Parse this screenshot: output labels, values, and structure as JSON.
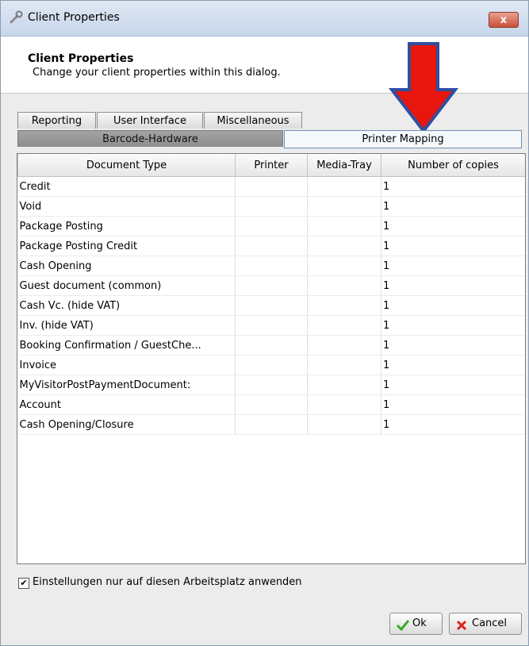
{
  "window": {
    "title": "Client Properties",
    "close_label": "x"
  },
  "header": {
    "title": "Client Properties",
    "subtitle": "Change your client properties within this dialog."
  },
  "tabs": {
    "row1": [
      {
        "label": "Reporting"
      },
      {
        "label": "User Interface"
      },
      {
        "label": "Miscellaneous"
      }
    ],
    "row2": [
      {
        "label": "Barcode-Hardware"
      },
      {
        "label": "Printer Mapping",
        "active": true
      }
    ]
  },
  "table": {
    "columns": [
      "Document Type",
      "Printer",
      "Media-Tray",
      "Number of copies"
    ],
    "rows": [
      {
        "document_type": "Credit",
        "printer": "",
        "media_tray": "",
        "copies": "1"
      },
      {
        "document_type": "Void",
        "printer": "",
        "media_tray": "",
        "copies": "1"
      },
      {
        "document_type": "Package Posting",
        "printer": "",
        "media_tray": "",
        "copies": "1"
      },
      {
        "document_type": "Package Posting Credit",
        "printer": "",
        "media_tray": "",
        "copies": "1"
      },
      {
        "document_type": "Cash Opening",
        "printer": "",
        "media_tray": "",
        "copies": "1"
      },
      {
        "document_type": "Guest document (common)",
        "printer": "",
        "media_tray": "",
        "copies": "1"
      },
      {
        "document_type": "Cash Vc. (hide VAT)",
        "printer": "",
        "media_tray": "",
        "copies": "1"
      },
      {
        "document_type": "Inv. (hide VAT)",
        "printer": "",
        "media_tray": "",
        "copies": "1"
      },
      {
        "document_type": "Booking Confirmation / GuestChe...",
        "printer": "",
        "media_tray": "",
        "copies": "1"
      },
      {
        "document_type": "Invoice",
        "printer": "",
        "media_tray": "",
        "copies": "1"
      },
      {
        "document_type": "MyVisitorPostPaymentDocument:",
        "printer": "",
        "media_tray": "",
        "copies": "1"
      },
      {
        "document_type": "Account",
        "printer": "",
        "media_tray": "",
        "copies": "1"
      },
      {
        "document_type": "Cash Opening/Closure",
        "printer": "",
        "media_tray": "",
        "copies": "1"
      }
    ]
  },
  "checkbox": {
    "label": "Einstellungen nur auf diesen Arbeitsplatz anwenden",
    "checked": true
  },
  "buttons": {
    "ok_label": "Ok",
    "cancel_label": "Cancel"
  },
  "annotation": {
    "arrow_color": "#e8160c",
    "arrow_outline": "#2f4fa0"
  }
}
